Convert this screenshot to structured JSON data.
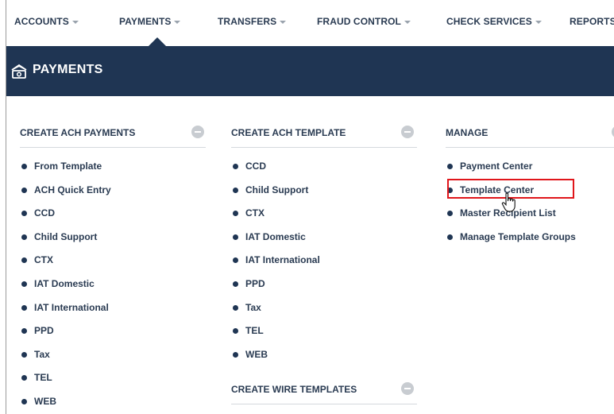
{
  "topnav": {
    "items": [
      {
        "label": "ACCOUNTS"
      },
      {
        "label": "PAYMENTS"
      },
      {
        "label": "TRANSFERS"
      },
      {
        "label": "FRAUD CONTROL"
      },
      {
        "label": "CHECK SERVICES"
      },
      {
        "label": "REPORTS"
      }
    ],
    "active": "PAYMENTS"
  },
  "banner": {
    "title": "PAYMENTS",
    "icon": "payments-icon",
    "bg_color": "#1f3553"
  },
  "columns": {
    "create_ach_payments": {
      "title": "CREATE ACH PAYMENTS",
      "items": [
        "From Template",
        "ACH Quick Entry",
        "CCD",
        "Child Support",
        "CTX",
        "IAT Domestic",
        "IAT International",
        "PPD",
        "Tax",
        "TEL",
        "WEB"
      ]
    },
    "create_ach_template": {
      "title": "CREATE ACH TEMPLATE",
      "items": [
        "CCD",
        "Child Support",
        "CTX",
        "IAT Domestic",
        "IAT International",
        "PPD",
        "Tax",
        "TEL",
        "WEB"
      ]
    },
    "create_wire_templates": {
      "title": "CREATE WIRE TEMPLATES"
    },
    "manage": {
      "title": "MANAGE",
      "items": [
        "Payment Center",
        "Template Center",
        "Master Recipient List",
        "Manage Template Groups"
      ],
      "highlighted": "Template Center"
    }
  },
  "colors": {
    "text": "#2a3b52",
    "highlight_border": "#e0161b",
    "collapse_button": "#c8ccd1"
  }
}
